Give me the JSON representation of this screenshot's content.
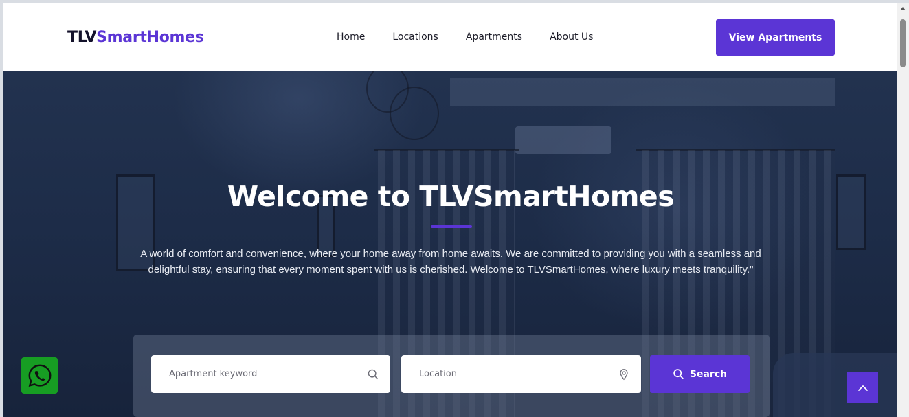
{
  "logo": {
    "part1": "TLV",
    "part2": "SmartHomes"
  },
  "nav": [
    {
      "label": "Home"
    },
    {
      "label": "Locations"
    },
    {
      "label": "Apartments"
    },
    {
      "label": "About Us"
    }
  ],
  "header": {
    "cta_label": "View Apartments"
  },
  "hero": {
    "title": "Welcome to TLVSmartHomes",
    "description": "A world of comfort and convenience, where your home away from home awaits. We are committed to providing you with a seamless and delightful stay, ensuring that every moment spent with us is cherished. Welcome to TLVSmartHomes, where luxury meets tranquility.\""
  },
  "search": {
    "keyword_placeholder": "Apartment keyword",
    "location_placeholder": "Location",
    "button_label": "Search"
  },
  "icons": {
    "search": "search-icon",
    "location": "map-pin-icon",
    "whatsapp": "whatsapp-icon",
    "to_top": "chevron-up-icon"
  },
  "colors": {
    "accent": "#5b35d5",
    "logo_dark": "#14122b",
    "whatsapp": "#179d23",
    "hero_overlay": "#1d2c48"
  }
}
